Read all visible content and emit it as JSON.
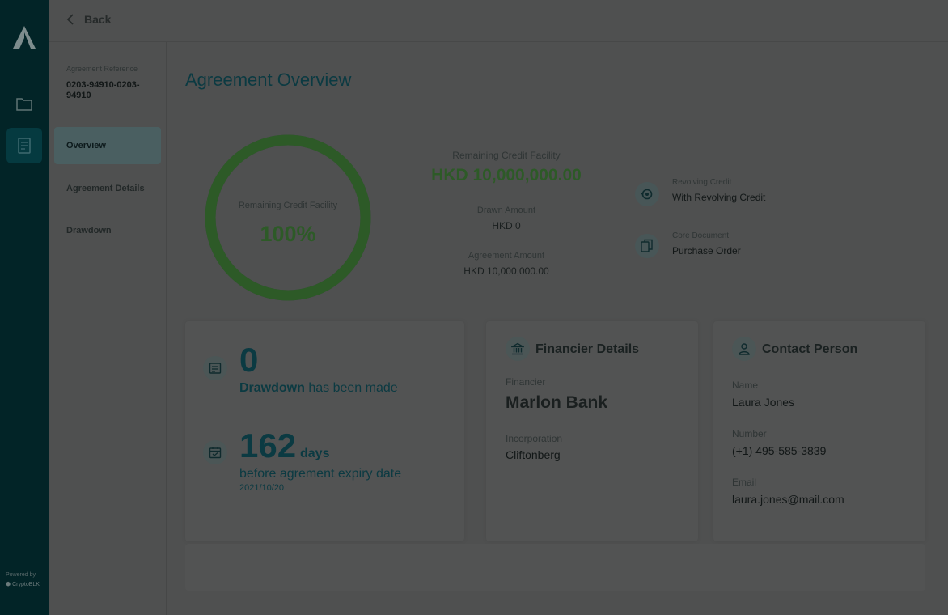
{
  "rail": {
    "powered_by": "Powered by",
    "brand": "CryptoBLK"
  },
  "topbar": {
    "back_label": "Back"
  },
  "subnav": {
    "ref_label": "Agreement Reference",
    "ref_value": "0203-94910-0203-94910",
    "items": [
      {
        "label": "Overview",
        "active": true
      },
      {
        "label": "Agreement Details",
        "active": false
      },
      {
        "label": "Drawdown",
        "active": false
      }
    ]
  },
  "main": {
    "title": "Agreement Overview",
    "donut": {
      "label": "Remaining Credit Facility",
      "value": "100%",
      "fraction": 1.0,
      "color": "#2d5a27"
    },
    "facility": {
      "label": "Remaining Credit Facility",
      "amount": "HKD 10,000,000.00",
      "drawn_label": "Drawn Amount",
      "drawn_value": "HKD 0",
      "agreement_label": "Agreement Amount",
      "agreement_value": "HKD 10,000,000.00"
    },
    "revolving": {
      "label": "Revolving Credit",
      "value": "With Revolving Credit",
      "icon": "revolving-icon"
    },
    "core_doc": {
      "label": "Core Document",
      "value": "Purchase Order",
      "icon": "documents-icon"
    }
  },
  "drawdown_card": {
    "count": "0",
    "drawdown_word": "Drawdown",
    "drawdown_rest": "has been made",
    "days_num": "162",
    "days_word": "days",
    "expiry_text": "before agrement expiry date",
    "expiry_date": "2021/10/20"
  },
  "financier_card": {
    "title": "Financier Details",
    "financier_label": "Financier",
    "financier_value": "Marlon Bank",
    "incorporation_label": "Incorporation",
    "incorporation_value": "Cliftonberg"
  },
  "contact_card": {
    "title": "Contact Person",
    "name_label": "Name",
    "name_value": "Laura Jones",
    "number_label": "Number",
    "number_value": "(+1) 495-585-3839",
    "email_label": "Email",
    "email_value": "laura.jones@mail.com"
  }
}
